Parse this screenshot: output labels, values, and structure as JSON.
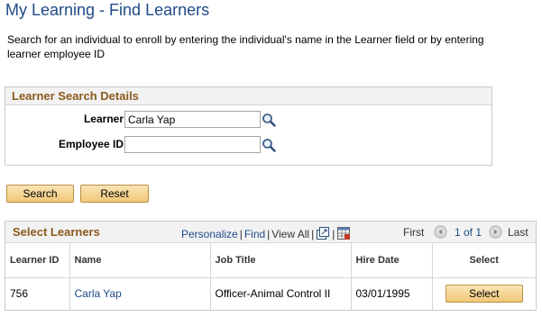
{
  "page": {
    "title": "My Learning - Find Learners",
    "instructions": "Search for an individual to enroll by entering the individual's name in the Learner field or by entering learner employee ID"
  },
  "search": {
    "header": "Learner Search Details",
    "learner_label": "Learner",
    "learner_value": "Carla Yap",
    "employee_label": "Employee ID",
    "employee_value": "",
    "lookup_icon": "magnifier-icon"
  },
  "actions": {
    "search_label": "Search",
    "reset_label": "Reset"
  },
  "grid": {
    "title": "Select Learners",
    "personalize": "Personalize",
    "find": "Find",
    "view_all": "View All",
    "first": "First",
    "page_info": "1 of 1",
    "last": "Last",
    "columns": [
      "Learner ID",
      "Name",
      "Job Title",
      "Hire Date",
      "Select"
    ],
    "rows": [
      {
        "learner_id": "756",
        "name": "Carla Yap",
        "job_title": "Officer-Animal Control II",
        "hire_date": "03/01/1995",
        "select_label": "Select"
      }
    ]
  },
  "colors": {
    "title_blue": "#1f4a86",
    "section_brown": "#8b5a1d",
    "button_gold": "#f0c878"
  }
}
